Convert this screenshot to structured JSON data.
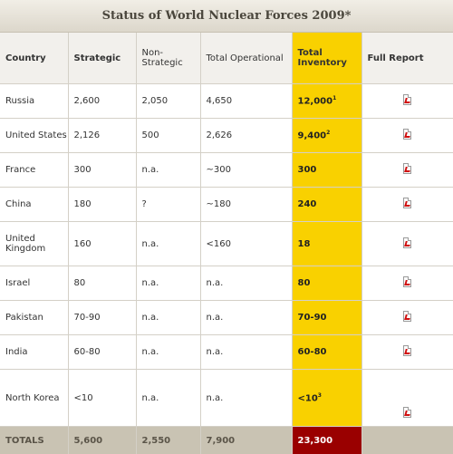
{
  "title": "Status of World Nuclear Forces 2009*",
  "headers": {
    "country": "Country",
    "strategic": "Strategic",
    "non_strategic": "Non-Strategic",
    "total_operational": "Total Operational",
    "total_inventory": "Total Inventory",
    "full_report": "Full Report"
  },
  "rows": [
    {
      "country": "Russia",
      "strategic": "2,600",
      "non_strategic": "2,050",
      "total_operational": "4,650",
      "total_inventory": "12,000",
      "footnote": "1"
    },
    {
      "country": "United States",
      "strategic": "2,126",
      "non_strategic": "500",
      "total_operational": "2,626",
      "total_inventory": "9,400",
      "footnote": "2"
    },
    {
      "country": "France",
      "strategic": "300",
      "non_strategic": "n.a.",
      "total_operational": "~300",
      "total_inventory": "300",
      "footnote": ""
    },
    {
      "country": "China",
      "strategic": "180",
      "non_strategic": "?",
      "total_operational": "~180",
      "total_inventory": "240",
      "footnote": ""
    },
    {
      "country": "United Kingdom",
      "strategic": "160",
      "non_strategic": "n.a.",
      "total_operational": "<160",
      "total_inventory": "18",
      "footnote": ""
    },
    {
      "country": "Israel",
      "strategic": "80",
      "non_strategic": "n.a.",
      "total_operational": "n.a.",
      "total_inventory": "80",
      "footnote": ""
    },
    {
      "country": "Pakistan",
      "strategic": "70-90",
      "non_strategic": "n.a.",
      "total_operational": "n.a.",
      "total_inventory": "70-90",
      "footnote": ""
    },
    {
      "country": "India",
      "strategic": "60-80",
      "non_strategic": "n.a.",
      "total_operational": "n.a.",
      "total_inventory": "60-80",
      "footnote": ""
    },
    {
      "country": "North Korea",
      "strategic": "<10",
      "non_strategic": "n.a.",
      "total_operational": "n.a.",
      "total_inventory": "<10",
      "footnote": "3"
    }
  ],
  "totals": {
    "label": "TOTALS",
    "strategic": "5,600",
    "non_strategic": "2,550",
    "total_operational": "7,900",
    "total_inventory": "23,300"
  },
  "icons": {
    "report": "pdf-document-icon"
  },
  "colors": {
    "inventory_highlight": "#f9d100",
    "totals_inventory": "#9a0000",
    "totals_row": "#c9c3b3"
  }
}
